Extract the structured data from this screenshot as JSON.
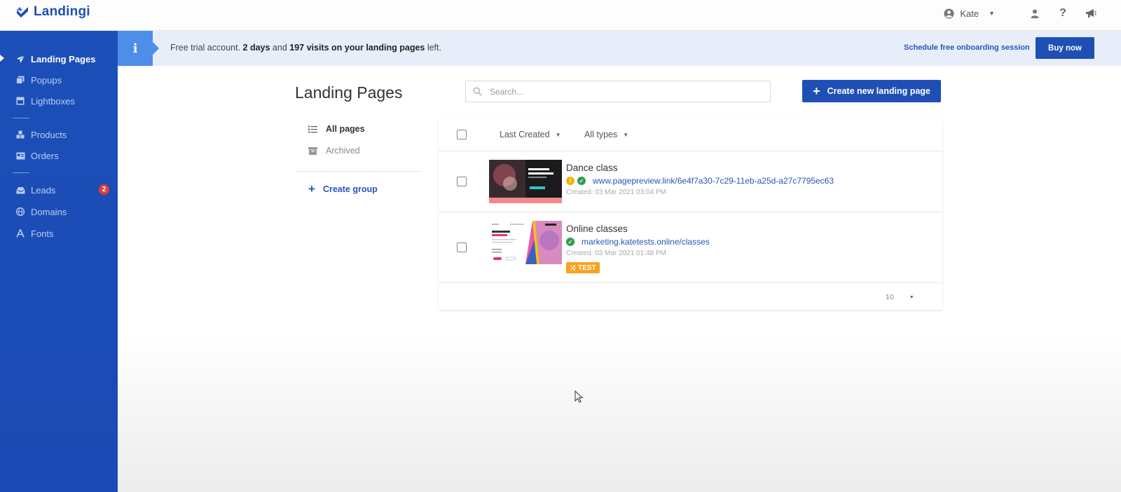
{
  "app": {
    "logo_text": "Landingi"
  },
  "header": {
    "user_name": "Kate"
  },
  "sidebar": {
    "items": [
      {
        "label": "Landing Pages",
        "icon": "paper-plane-icon",
        "active": true
      },
      {
        "label": "Popups",
        "icon": "popups-icon"
      },
      {
        "label": "Lightboxes",
        "icon": "lightbox-icon"
      },
      {
        "label": "Products",
        "icon": "products-icon"
      },
      {
        "label": "Orders",
        "icon": "orders-icon"
      },
      {
        "label": "Leads",
        "icon": "inbox-icon",
        "badge": "2"
      },
      {
        "label": "Domains",
        "icon": "globe-icon"
      },
      {
        "label": "Fonts",
        "icon": "font-icon"
      }
    ]
  },
  "banner": {
    "text_prefix": "Free trial account. ",
    "days": "2 days",
    "text_mid": " and ",
    "visits": "197 visits on your landing pages",
    "text_suffix": " left.",
    "onboarding_link": "Schedule free onboarding session",
    "buy_button": "Buy now"
  },
  "main": {
    "title": "Landing Pages",
    "search_placeholder": "Search...",
    "create_button": "Create new landing page",
    "filters": [
      {
        "label": "All pages",
        "active": true
      },
      {
        "label": "Archived",
        "active": false
      }
    ],
    "create_group": "Create group"
  },
  "table": {
    "sort_label": "Last Created",
    "type_filter": "All types",
    "rows": [
      {
        "title": "Dance class",
        "url": "www.pagepreview.link/6e4f7a30-7c29-11eb-a25d-a27c7795ec63",
        "status": [
          "warning",
          "ok"
        ],
        "created": "Created: 03 Mar 2021 03:04 PM"
      },
      {
        "title": "Online classes",
        "url": "marketing.katetests.online/classes",
        "status": [
          "ok"
        ],
        "created": "Created: 03 Mar 2021 01:48 PM",
        "badge": "TEST"
      }
    ],
    "per_page": "10"
  },
  "colors": {
    "brand": "#1f4fb5",
    "sidebar": "#1c4fb8",
    "banner": "#e8eef9",
    "info": "#4d8ee8",
    "badge": "#e03c3c",
    "test": "#f6a321",
    "ok": "#2e9e4f",
    "warning": "#f0b400"
  }
}
